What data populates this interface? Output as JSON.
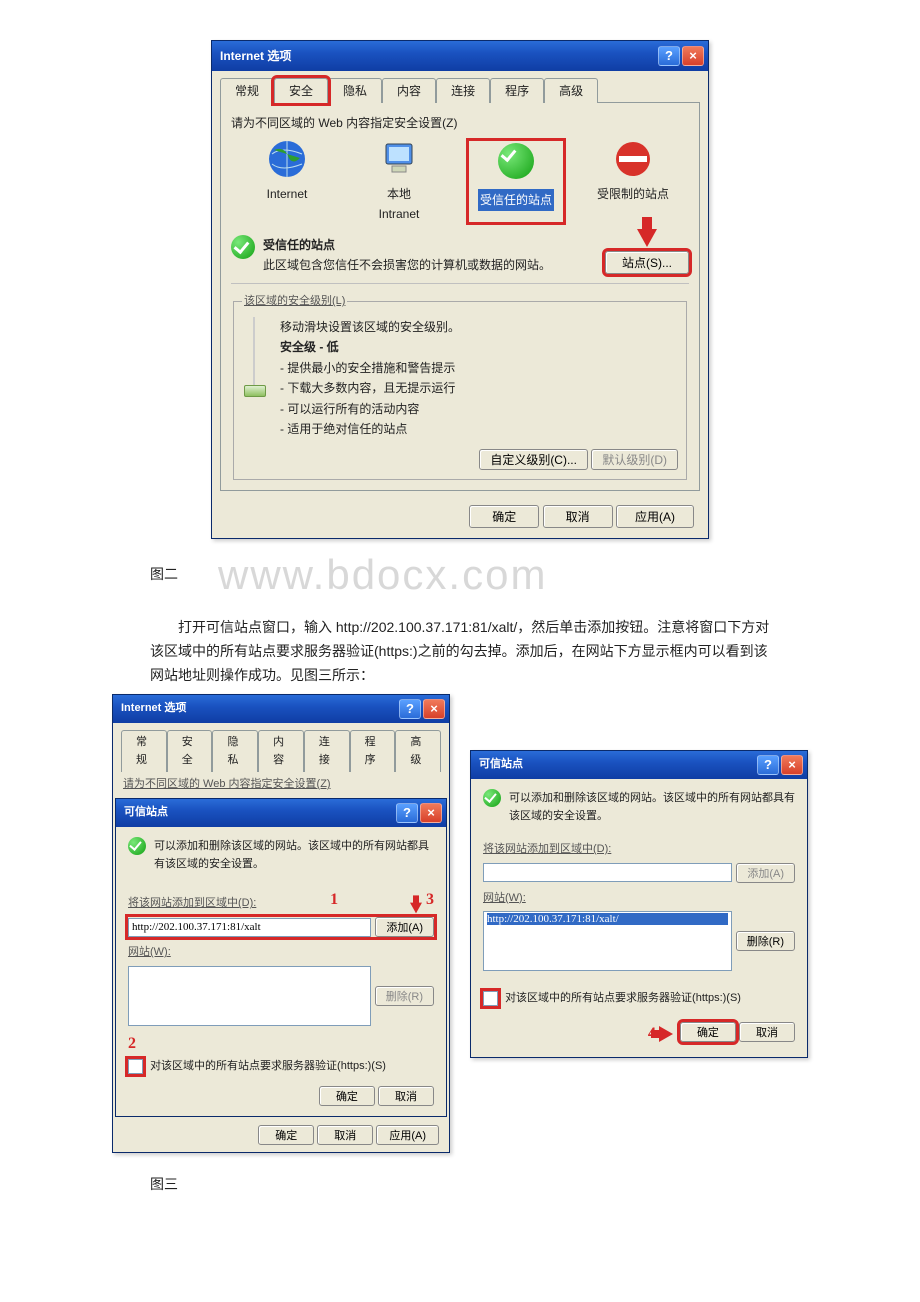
{
  "dlg1": {
    "title": "Internet 选项",
    "tabs": [
      "常规",
      "安全",
      "隐私",
      "内容",
      "连接",
      "程序",
      "高级"
    ],
    "activeTab": 1,
    "zonePrompt": "请为不同区域的 Web 内容指定安全设置(Z)",
    "zones": {
      "internet": "Internet",
      "intranet": "本地\nIntranet",
      "trusted": "受信任的站点",
      "restricted": "受限制的站点"
    },
    "trustedTitle": "受信任的站点",
    "trustedDesc": "此区域包含您信任不会损害您的计算机或数据的网站。",
    "sitesBtn": "站点(S)...",
    "levelTitle": "该区域的安全级别(L)",
    "sliderHelp": "移动滑块设置该区域的安全级别。",
    "levelName": "安全级 - 低",
    "levelLines": [
      "- 提供最小的安全措施和警告提示",
      "- 下载大多数内容，且无提示运行",
      "- 可以运行所有的活动内容",
      "- 适用于绝对信任的站点"
    ],
    "customBtn": "自定义级别(C)...",
    "defaultBtn": "默认级别(D)",
    "ok": "确定",
    "cancel": "取消",
    "apply": "应用(A)"
  },
  "caption1": "图二",
  "watermark": "www.bdocx.com",
  "para1": "打开可信站点窗口，输入 http://202.100.37.171:81/xalt/，然后单击添加按钮。注意将窗口下方对该区域中的所有站点要求服务器验证(https:)之前的勾去掉。添加后，在网站下方显示框内可以看到该网站地址则操作成功。见图三所示：",
  "dlg2": {
    "outerTitle": "Internet 选项",
    "tabs": [
      "常规",
      "安全",
      "隐私",
      "内容",
      "连接",
      "程序",
      "高级"
    ],
    "zonePrompt": "请为不同区域的 Web 内容指定安全设置(Z)",
    "title": "可信站点",
    "desc": "可以添加和删除该区域的网站。该区域中的所有网站都具有该区域的安全设置。",
    "addLabel": "将该网站添加到区域中(D):",
    "addValue": "http://202.100.37.171:81/xalt",
    "addBtn": "添加(A)",
    "sitesLabel": "网站(W):",
    "removeBtn": "删除(R)",
    "httpsLabel": "对该区域中的所有站点要求服务器验证(https:)(S)",
    "ok": "确定",
    "cancel": "取消",
    "apply": "应用(A)",
    "mark1": "1",
    "mark2": "2",
    "mark3": "3"
  },
  "dlg3": {
    "title": "可信站点",
    "desc": "可以添加和删除该区域的网站。该区域中的所有网站都具有该区域的安全设置。",
    "addLabel": "将该网站添加到区域中(D):",
    "addBtn": "添加(A)",
    "sitesLabel": "网站(W):",
    "siteItem": "http://202.100.37.171:81/xalt/",
    "removeBtn": "删除(R)",
    "httpsLabel": "对该区域中的所有站点要求服务器验证(https:)(S)",
    "ok": "确定",
    "cancel": "取消",
    "mark4": "4"
  },
  "caption2": "图三"
}
